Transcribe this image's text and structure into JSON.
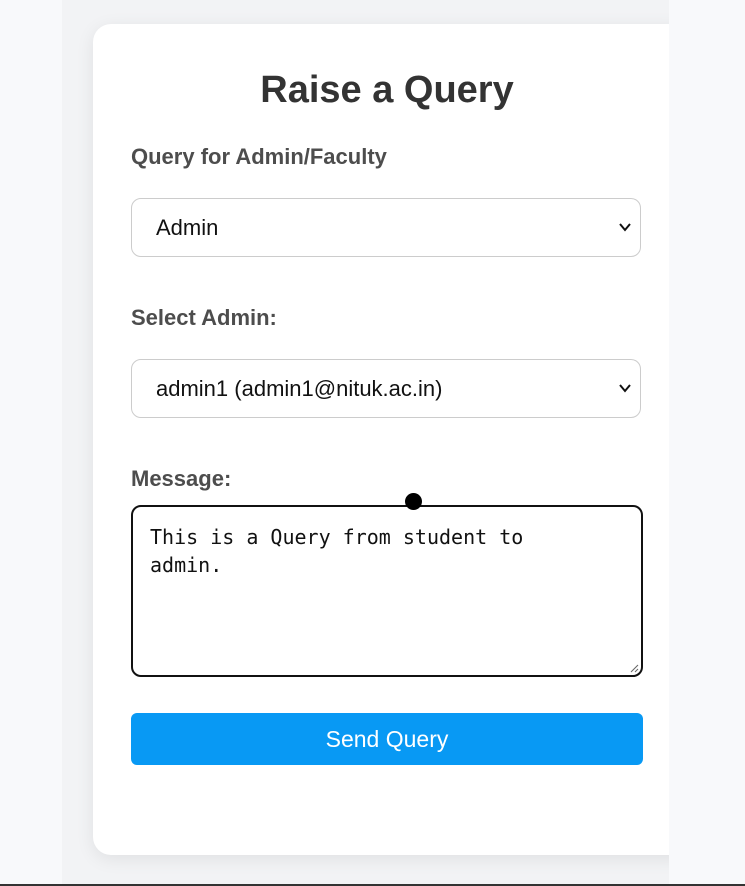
{
  "page": {
    "title": "Raise a Query"
  },
  "form": {
    "query_for_label": "Query for Admin/Faculty",
    "query_for_value": "Admin",
    "select_admin_label": "Select Admin:",
    "select_admin_value": "admin1 (admin1@nituk.ac.in)",
    "message_label": "Message:",
    "message_value": "This is a Query from student to\nadmin.",
    "send_button_label": "Send Query"
  },
  "colors": {
    "button_bg": "#0899f4",
    "title_text": "#333333",
    "label_text": "#4d4d4d"
  },
  "icons": {
    "dropdown": "chevron-down-icon",
    "textarea_resize": "resize-handle-icon"
  }
}
